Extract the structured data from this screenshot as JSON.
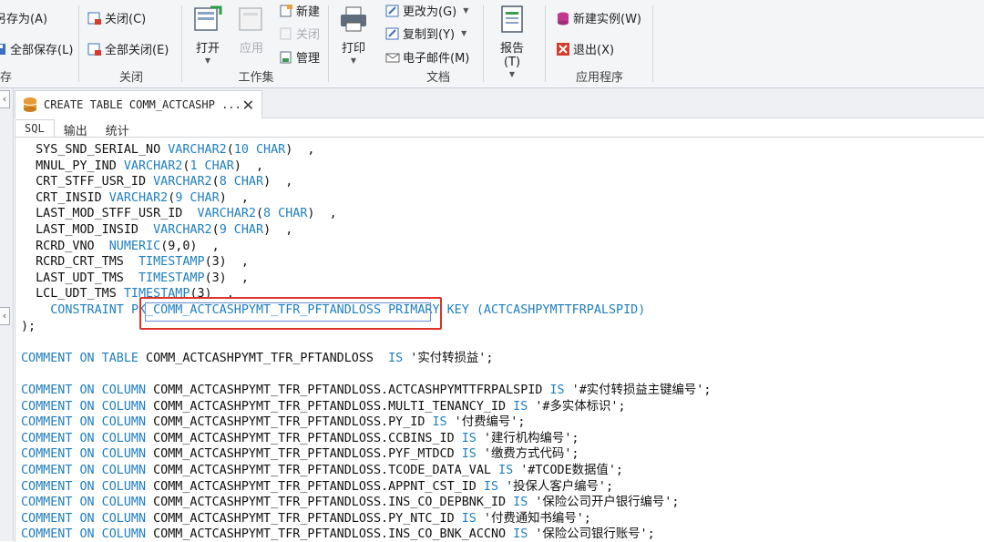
{
  "ribbon": {
    "save_as": "另存为(A)",
    "save_all": "全部保存(L)",
    "close": "关闭(C)",
    "close_all": "全部关闭(E)",
    "open": "打开",
    "apply": "应用",
    "new": "新建",
    "close_ws": "关闭",
    "manage": "管理",
    "print": "打印",
    "change_to": "更改为(G)",
    "copy_to": "复制到(Y)",
    "email": "电子邮件(M)",
    "report": "报告(T)",
    "new_instance": "新建实例(W)",
    "exit": "退出(X)",
    "groups": {
      "save": "存",
      "close": "关闭",
      "workset": "工作集",
      "document": "文档",
      "app": "应用程序"
    }
  },
  "tab": {
    "title": "CREATE TABLE COMM_ACTCASHP ..."
  },
  "subtabs": [
    "SQL",
    "输出",
    "统计"
  ],
  "code": [
    [
      [
        "p",
        "  SYS_SND_SERIAL_NO "
      ],
      [
        "k",
        "VARCHAR2"
      ],
      [
        "p",
        "("
      ],
      [
        "k",
        "10 CHAR"
      ],
      [
        "p",
        ")  ,"
      ]
    ],
    [
      [
        "p",
        "  MNUL_PY_IND "
      ],
      [
        "k",
        "VARCHAR2"
      ],
      [
        "p",
        "("
      ],
      [
        "k",
        "1 CHAR"
      ],
      [
        "p",
        ")  ,"
      ]
    ],
    [
      [
        "p",
        "  CRT_STFF_USR_ID "
      ],
      [
        "k",
        "VARCHAR2"
      ],
      [
        "p",
        "("
      ],
      [
        "k",
        "8 CHAR"
      ],
      [
        "p",
        ")  ,"
      ]
    ],
    [
      [
        "p",
        "  CRT_INSID "
      ],
      [
        "k",
        "VARCHAR2"
      ],
      [
        "p",
        "("
      ],
      [
        "k",
        "9 CHAR"
      ],
      [
        "p",
        ")  ,"
      ]
    ],
    [
      [
        "p",
        "  LAST_MOD_STFF_USR_ID  "
      ],
      [
        "k",
        "VARCHAR2"
      ],
      [
        "p",
        "("
      ],
      [
        "k",
        "8 CHAR"
      ],
      [
        "p",
        ")  ,"
      ]
    ],
    [
      [
        "p",
        "  LAST_MOD_INSID  "
      ],
      [
        "k",
        "VARCHAR2"
      ],
      [
        "p",
        "("
      ],
      [
        "k",
        "9 CHAR"
      ],
      [
        "p",
        ")  ,"
      ]
    ],
    [
      [
        "p",
        "  RCRD_VNO  "
      ],
      [
        "k",
        "NUMERIC"
      ],
      [
        "p",
        "(9,0)  ,"
      ]
    ],
    [
      [
        "p",
        "  RCRD_CRT_TMS  "
      ],
      [
        "k",
        "TIMESTAMP"
      ],
      [
        "p",
        "(3)  ,"
      ]
    ],
    [
      [
        "p",
        "  LAST_UDT_TMS  "
      ],
      [
        "k",
        "TIMESTAMP"
      ],
      [
        "p",
        "(3)  ,"
      ]
    ],
    [
      [
        "p",
        "  LCL_UDT_TMS "
      ],
      [
        "k",
        "TIMESTAMP"
      ],
      [
        "p",
        "(3)  ,"
      ]
    ],
    [
      [
        "p",
        "    "
      ],
      [
        "k",
        "CONSTRAINT"
      ],
      [
        "p",
        " "
      ],
      [
        "k",
        "PK_COMM_ACTCASHPYMT_TFR_PFTANDLOSS"
      ],
      [
        "p",
        " "
      ],
      [
        "k",
        "PRIMARY KEY"
      ],
      [
        "p",
        " "
      ],
      [
        "k",
        "(ACTCASHPYMTTFRPALSPID)"
      ]
    ],
    [
      [
        "p",
        ");"
      ]
    ],
    [],
    [
      [
        "k",
        "COMMENT ON TABLE"
      ],
      [
        "p",
        " COMM_ACTCASHPYMT_TFR_PFTANDLOSS  "
      ],
      [
        "k",
        "IS"
      ],
      [
        "p",
        " '实付转损益';"
      ]
    ],
    [],
    [
      [
        "k",
        "COMMENT ON COLUMN"
      ],
      [
        "p",
        " COMM_ACTCASHPYMT_TFR_PFTANDLOSS.ACTCASHPYMTTFRPALSPID "
      ],
      [
        "k",
        "IS"
      ],
      [
        "p",
        " '#实付转损益主键编号';"
      ]
    ],
    [
      [
        "k",
        "COMMENT ON COLUMN"
      ],
      [
        "p",
        " COMM_ACTCASHPYMT_TFR_PFTANDLOSS.MULTI_TENANCY_ID "
      ],
      [
        "k",
        "IS"
      ],
      [
        "p",
        " '#多实体标识';"
      ]
    ],
    [
      [
        "k",
        "COMMENT ON COLUMN"
      ],
      [
        "p",
        " COMM_ACTCASHPYMT_TFR_PFTANDLOSS.PY_ID "
      ],
      [
        "k",
        "IS"
      ],
      [
        "p",
        " '付费编号';"
      ]
    ],
    [
      [
        "k",
        "COMMENT ON COLUMN"
      ],
      [
        "p",
        " COMM_ACTCASHPYMT_TFR_PFTANDLOSS.CCBINS_ID "
      ],
      [
        "k",
        "IS"
      ],
      [
        "p",
        " '建行机构编号';"
      ]
    ],
    [
      [
        "k",
        "COMMENT ON COLUMN"
      ],
      [
        "p",
        " COMM_ACTCASHPYMT_TFR_PFTANDLOSS.PYF_MTDCD "
      ],
      [
        "k",
        "IS"
      ],
      [
        "p",
        " '缴费方式代码';"
      ]
    ],
    [
      [
        "k",
        "COMMENT ON COLUMN"
      ],
      [
        "p",
        " COMM_ACTCASHPYMT_TFR_PFTANDLOSS.TCODE_DATA_VAL "
      ],
      [
        "k",
        "IS"
      ],
      [
        "p",
        " '#TCODE数据值';"
      ]
    ],
    [
      [
        "k",
        "COMMENT ON COLUMN"
      ],
      [
        "p",
        " COMM_ACTCASHPYMT_TFR_PFTANDLOSS.APPNT_CST_ID "
      ],
      [
        "k",
        "IS"
      ],
      [
        "p",
        " '投保人客户编号';"
      ]
    ],
    [
      [
        "k",
        "COMMENT ON COLUMN"
      ],
      [
        "p",
        " COMM_ACTCASHPYMT_TFR_PFTANDLOSS.INS_CO_DEPBNK_ID "
      ],
      [
        "k",
        "IS"
      ],
      [
        "p",
        " '保险公司开户银行编号';"
      ]
    ],
    [
      [
        "k",
        "COMMENT ON COLUMN"
      ],
      [
        "p",
        " COMM_ACTCASHPYMT_TFR_PFTANDLOSS.PY_NTC_ID "
      ],
      [
        "k",
        "IS"
      ],
      [
        "p",
        " '付费通知书编号';"
      ]
    ],
    [
      [
        "k",
        "COMMENT ON COLUMN"
      ],
      [
        "p",
        " COMM_ACTCASHPYMT_TFR_PFTANDLOSS.INS_CO_BNK_ACCNO "
      ],
      [
        "k",
        "IS"
      ],
      [
        "p",
        " '保险公司银行账号';"
      ]
    ]
  ]
}
